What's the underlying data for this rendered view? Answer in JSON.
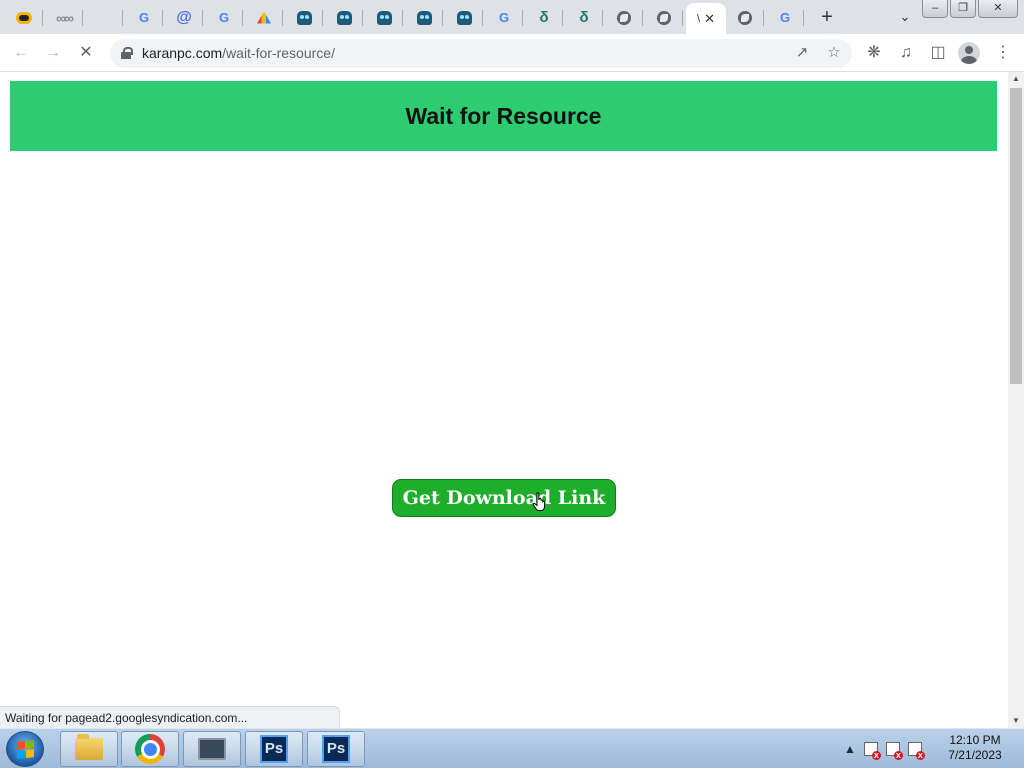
{
  "browser": {
    "tabs": [
      {
        "icon": "game-controller-icon",
        "type": "game"
      },
      {
        "icon": "infinity-icon",
        "type": "inf"
      },
      {
        "icon": "microsoft-icon",
        "type": "ms"
      },
      {
        "icon": "google-icon",
        "type": "g"
      },
      {
        "icon": "at-sign-icon",
        "type": "at"
      },
      {
        "icon": "google-icon",
        "type": "g"
      },
      {
        "icon": "drive-icon",
        "type": "drive"
      },
      {
        "icon": "robot-icon",
        "type": "robot"
      },
      {
        "icon": "robot-icon",
        "type": "robot"
      },
      {
        "icon": "robot-icon",
        "type": "robot"
      },
      {
        "icon": "robot-icon",
        "type": "robot"
      },
      {
        "icon": "robot-icon",
        "type": "robot"
      },
      {
        "icon": "google-icon",
        "type": "g"
      },
      {
        "icon": "seal-icon",
        "type": "seal"
      },
      {
        "icon": "seal-icon",
        "type": "seal"
      },
      {
        "icon": "globe-icon",
        "type": "globe"
      },
      {
        "icon": "globe-icon",
        "type": "globe"
      }
    ],
    "active_tab": {
      "title": "\\",
      "close": "✕"
    },
    "trailing_tabs": [
      {
        "icon": "globe-icon",
        "type": "globe"
      },
      {
        "icon": "google-icon",
        "type": "g"
      }
    ],
    "new_tab_label": "+",
    "url_domain": "karanpc.com",
    "url_path": "/wait-for-resource/"
  },
  "page": {
    "heading": "Wait for Resource",
    "button_label": "Get Download Link",
    "status_text": "Waiting for pagead2.googlesyndication.com...",
    "colors": {
      "banner": "#2ecc71",
      "button": "#1fad2c"
    }
  },
  "taskbar": {
    "ps_label": "Ps",
    "clock_time": "12:10 PM",
    "clock_date": "7/21/2023"
  }
}
